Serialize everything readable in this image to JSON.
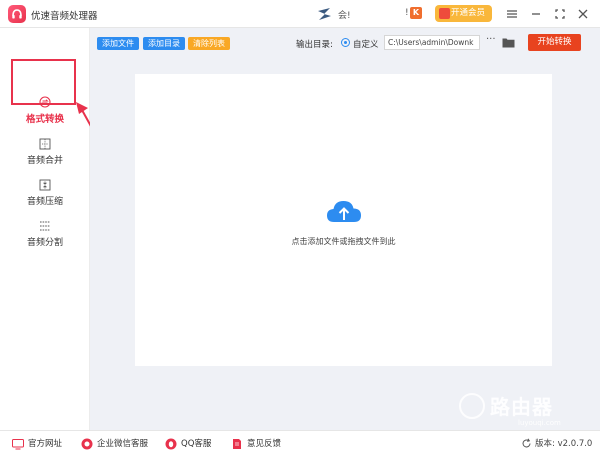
{
  "app": {
    "title": "优速音频处理器"
  },
  "header": {
    "user_name": "会!",
    "vip_divider": "!",
    "vip_badge": "K",
    "vip_button_label": "开通会员"
  },
  "sidebar": {
    "items": [
      {
        "label": "格式转换",
        "icon": "convert-icon",
        "active": true
      },
      {
        "label": "音频合并",
        "icon": "merge-icon",
        "active": false
      },
      {
        "label": "音频压缩",
        "icon": "compress-icon",
        "active": false
      },
      {
        "label": "音频分割",
        "icon": "split-icon",
        "active": false
      }
    ]
  },
  "toolbar": {
    "add_file_label": "添加文件",
    "add_folder_label": "添加目录",
    "clear_list_label": "清除列表",
    "output_dir_label": "输出目录:",
    "custom_label": "自定义",
    "path_value": "C:\\Users\\admin\\Downk",
    "more_label": "···",
    "start_label": "开始转换"
  },
  "drop_zone": {
    "hint": "点击添加文件或拖拽文件到此"
  },
  "footer": {
    "site_label": "官方网址",
    "wechat_label": "企业微信客服",
    "qq_label": "QQ客服",
    "feedback_label": "意见反馈",
    "version_label": "版本: v2.0.7.0"
  },
  "watermark": {
    "title": "路由器",
    "url": "luyouqi.com"
  },
  "colors": {
    "brand": "#e8324c",
    "primary": "#2d8cf0",
    "clear": "#f9a825",
    "start": "#e8431f",
    "vip": "#f9b73b",
    "main_bg": "#eff1f6"
  }
}
